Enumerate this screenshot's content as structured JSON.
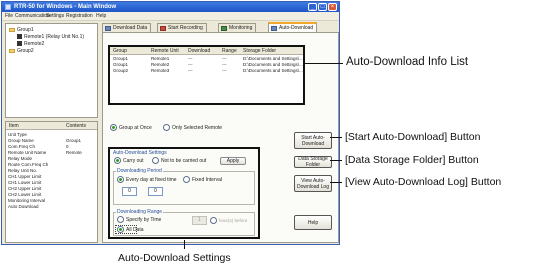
{
  "window": {
    "title": "RTR-50 for Windows - Main Window",
    "controls": [
      "_",
      "□",
      "×"
    ],
    "menu": [
      "File",
      "Communication",
      "Settings",
      "Registration",
      "Help"
    ]
  },
  "tree": {
    "items": [
      {
        "label": "Group1",
        "icon": "folder-icon"
      },
      {
        "label": "Remote1 (Relay Unit No.1)",
        "icon": "remote-unit-icon"
      },
      {
        "label": "Remote2",
        "icon": "remote-unit-icon"
      },
      {
        "label": "Group2",
        "icon": "folder-icon"
      }
    ]
  },
  "properties": {
    "headers": [
      "Item",
      "Contents"
    ],
    "rows": [
      {
        "item": "Unit Type",
        "value": ""
      },
      {
        "item": "Group Name",
        "value": "Group1"
      },
      {
        "item": "Com.Freq Ch",
        "value": "0"
      },
      {
        "item": "Remote Unit Name",
        "value": "Remote"
      },
      {
        "item": "Relay Mode",
        "value": ""
      },
      {
        "item": "Route Com.Freq Ch",
        "value": ""
      },
      {
        "item": "Relay Unit No.",
        "value": ""
      },
      {
        "item": "CH1 Upper Limit",
        "value": ""
      },
      {
        "item": "CH1 Lower Limit",
        "value": ""
      },
      {
        "item": "CH2 Upper Limit",
        "value": ""
      },
      {
        "item": "CH2 Lower Limit",
        "value": ""
      },
      {
        "item": "Monitoring Interval",
        "value": ""
      },
      {
        "item": "Auto Download",
        "value": ""
      }
    ]
  },
  "tabs": [
    {
      "label": "Download Data",
      "active": false
    },
    {
      "label": "Start Recording",
      "active": false
    },
    {
      "label": "Monitoring",
      "active": false
    },
    {
      "label": "Auto-Download",
      "active": true
    }
  ],
  "info_list": {
    "headers": [
      "Group",
      "Remote Unit",
      "Download",
      "Range",
      "Storage Folder"
    ],
    "rows": [
      [
        "Group1",
        "Remote1",
        "---",
        "---",
        "D:\\Documents and Settings\\..."
      ],
      [
        "Group1",
        "Remote2",
        "---",
        "---",
        "D:\\Documents and Settings\\..."
      ],
      [
        "Group2",
        "Remote3",
        "---",
        "---",
        "D:\\Documents and Settings\\..."
      ]
    ]
  },
  "target": {
    "group_at_once": "Group at Once",
    "only_selected_remote": "Only Selected Remote",
    "selected_value": "Group at Once"
  },
  "settings": {
    "title": "Auto-Download Settings",
    "carry_out": "Carry out",
    "not_carry_out": "Not to be carried out",
    "apply": "Apply",
    "period_title": "Downloading Period",
    "every_day": "Every day at fixed time",
    "fixed_interval": "Fixed Interval",
    "hour": "0",
    "minute": "0",
    "range_title": "Downloading Range",
    "specify_by_time": "Specify by Time",
    "all_data": "All Data",
    "specify_value": "1",
    "specify_unit": "hour(s) before"
  },
  "buttons": {
    "start": "Start Auto-Download",
    "storage": "Data Storage Folder",
    "log": "View Auto-Download Log",
    "help": "Help"
  },
  "callouts": {
    "info_list": "Auto-Download Info List",
    "start": "[Start Auto-Download] Button",
    "storage": "[Data Storage Folder] Button",
    "log": "[View Auto-Download Log] Button",
    "settings": "Auto-Download Settings"
  },
  "colors": {
    "titlebar": "#1f55c8",
    "window_bg": "#ece9d8",
    "active_tab_accent": "#f0a830",
    "radio_selected": "#2da11f",
    "group_label": "#2a4f9c"
  }
}
